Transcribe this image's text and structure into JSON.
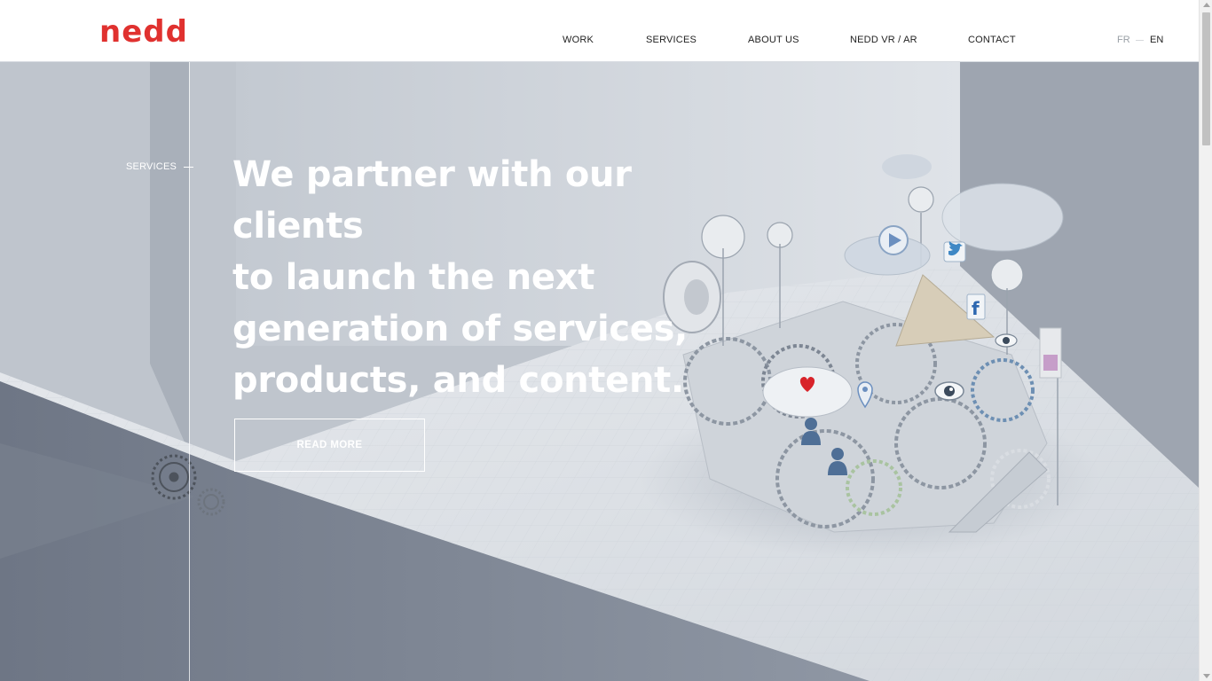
{
  "brand": {
    "logo_text": "nedd",
    "logo_color": "#e0312f"
  },
  "nav": {
    "items": [
      {
        "label": "WORK"
      },
      {
        "label": "SERVICES"
      },
      {
        "label": "ABOUT US"
      },
      {
        "label": "NEDD VR / AR"
      },
      {
        "label": "CONTACT"
      }
    ]
  },
  "language": {
    "fr": "FR",
    "en": "EN",
    "active": "EN"
  },
  "hero": {
    "section_label": "SERVICES",
    "headline_lines": [
      "We partner with our clients",
      "to launch the next",
      "generation of services,",
      "products, and content."
    ],
    "cta_label": "READ MORE",
    "illustration": "gears-and-social-icons-machine"
  },
  "icons": {
    "play": "play-icon",
    "twitter": "twitter-icon",
    "facebook": "facebook-icon",
    "heart": "heart-icon",
    "eye": "eye-icon",
    "map_pin": "map-pin-icon"
  },
  "colors": {
    "accent": "#e0312f",
    "hero_text": "#ffffff",
    "nav_text": "#222222"
  }
}
